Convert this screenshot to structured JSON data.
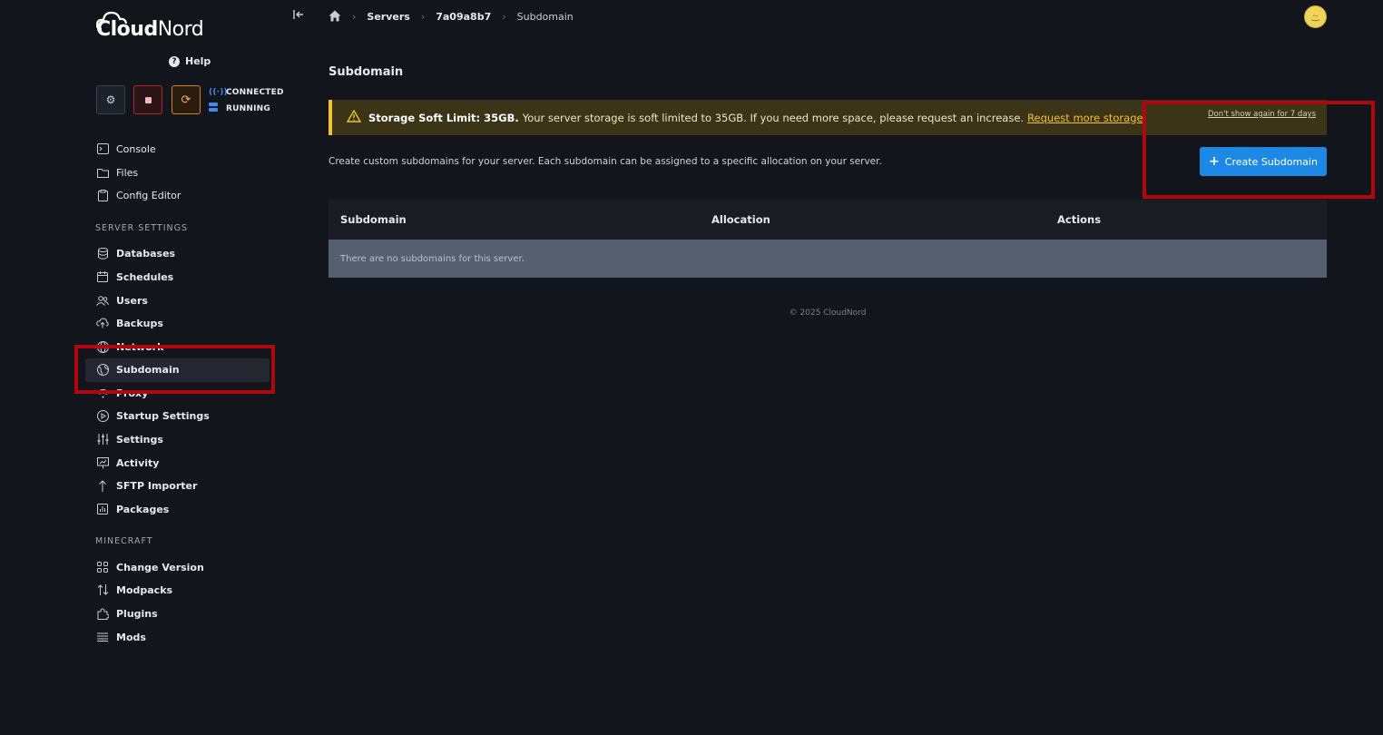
{
  "brand": {
    "part1": "Cloud",
    "part2": "Nord"
  },
  "help_label": "Help",
  "controls": {
    "gear": "⚙",
    "restart": "⟳"
  },
  "status": {
    "connection": "CONNECTED",
    "state": "RUNNING"
  },
  "nav_primary": [
    {
      "label": "Console"
    },
    {
      "label": "Files"
    },
    {
      "label": "Config Editor"
    }
  ],
  "section_server": "SERVER SETTINGS",
  "nav_server": [
    {
      "label": "Databases"
    },
    {
      "label": "Schedules"
    },
    {
      "label": "Users"
    },
    {
      "label": "Backups"
    },
    {
      "label": "Network"
    },
    {
      "label": "Subdomain"
    },
    {
      "label": "Proxy"
    },
    {
      "label": "Startup Settings"
    },
    {
      "label": "Settings"
    },
    {
      "label": "Activity"
    },
    {
      "label": "SFTP Importer"
    },
    {
      "label": "Packages"
    }
  ],
  "section_minecraft": "MINECRAFT",
  "nav_minecraft": [
    {
      "label": "Change Version"
    },
    {
      "label": "Modpacks"
    },
    {
      "label": "Plugins"
    },
    {
      "label": "Mods"
    }
  ],
  "breadcrumb": {
    "servers": "Servers",
    "server_id": "7a09a8b7",
    "current": "Subdomain"
  },
  "page_title": "Subdomain",
  "alert": {
    "title": "Storage Soft Limit: 35GB.",
    "message": "Your server storage is soft limited to 35GB. If you need more space, please request an increase.",
    "link": "Request more storage",
    "period": ".",
    "dismiss": "Don't show again for 7 days"
  },
  "description": "Create custom subdomains for your server. Each subdomain can be assigned to a specific allocation on your server.",
  "create_button": "Create Subdomain",
  "table": {
    "columns": [
      "Subdomain",
      "Allocation",
      "Actions"
    ],
    "empty": "There are no subdomains for this server."
  },
  "footer": "© 2025 CloudNord",
  "colors": {
    "accent": "#1e88e5",
    "warning": "#f2c230",
    "stop": "#b3262b",
    "restart": "#d4811b",
    "annotation": "#b0060c"
  }
}
